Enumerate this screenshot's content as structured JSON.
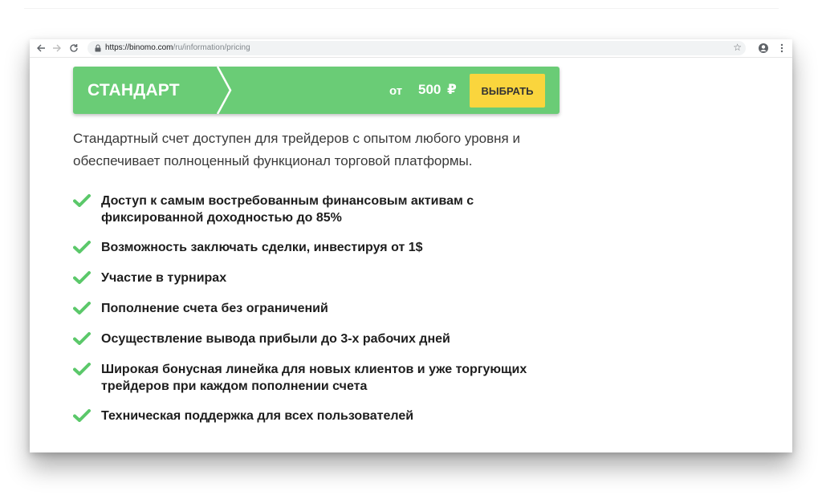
{
  "browser": {
    "url_host": "https://binomo.com",
    "url_path": "/ru/information/pricing",
    "icons": [
      "back-arrow-icon",
      "forward-arrow-icon",
      "reload-icon",
      "lock-icon",
      "star-icon",
      "account-icon",
      "menu-kebab-icon"
    ]
  },
  "plan": {
    "name": "СТАНДАРТ",
    "price_prefix": "от",
    "price_value": "500",
    "currency": "₽",
    "select_label": "ВЫБРАТЬ",
    "colors": {
      "bar": "#6acc76",
      "button": "#fad53d"
    }
  },
  "description": "Стандартный счет доступен для трейдеров с опытом любого уровня и обеспечивает полноценный функционал торговой платформы.",
  "features": [
    "Доступ к самым востребованным финансовым активам с фиксированной доходностью до 85%",
    "Возможность заключать сделки, инвестируя от 1$",
    "Участие в турнирах",
    "Пополнение счета без ограничений",
    "Осуществление вывода прибыли до 3-х рабочих дней",
    "Широкая бонусная линейка для новых клиентов и уже торгующих трейдеров при каждом пополнении счета",
    "Техническая поддержка для всех пользователей"
  ],
  "check_color": "#5bc86a"
}
